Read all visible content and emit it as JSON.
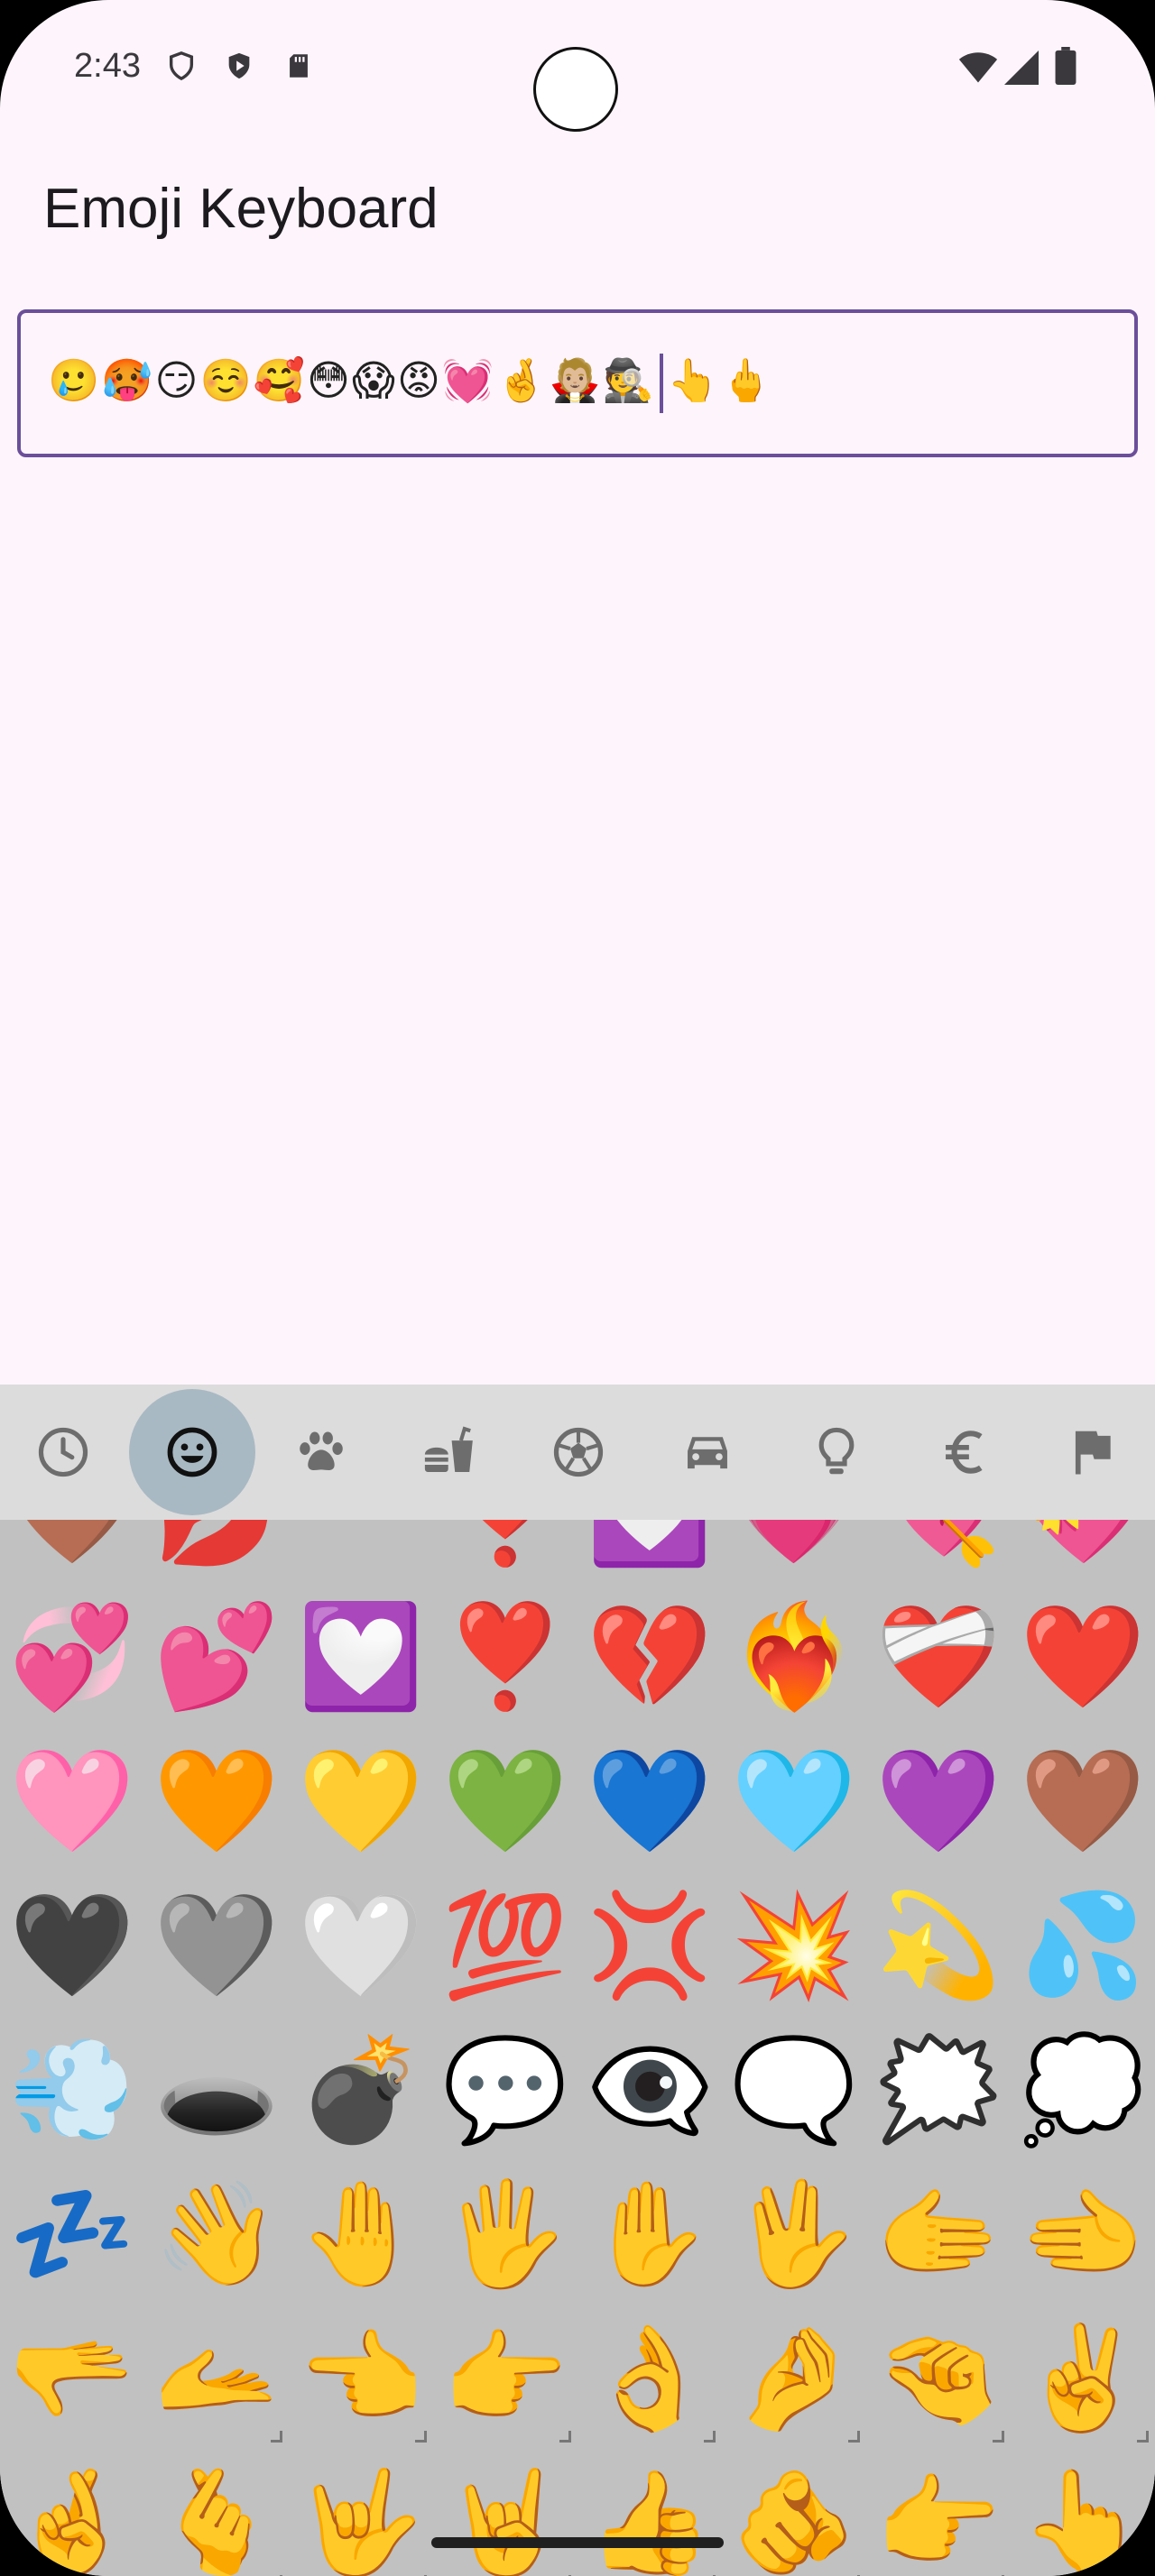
{
  "status_bar": {
    "time": "2:43",
    "left_icons": [
      "shield-outline-icon",
      "shield-play-icon",
      "sd-card-icon"
    ],
    "right_icons": [
      "wifi-icon",
      "signal-icon",
      "battery-icon"
    ]
  },
  "app": {
    "title": "Emoji Keyboard"
  },
  "input": {
    "text_before_caret": "🥲🥵😏☺️🥰😳😱😡💓🤞🧛🏼🕵️",
    "text_after_caret": "👆🖕"
  },
  "categories": [
    {
      "name": "recent",
      "icon": "clock-icon",
      "active": false
    },
    {
      "name": "smileys",
      "icon": "smiley-icon",
      "active": true
    },
    {
      "name": "animals",
      "icon": "paw-icon",
      "active": false
    },
    {
      "name": "food",
      "icon": "burger-drink-icon",
      "active": false
    },
    {
      "name": "activities",
      "icon": "soccer-ball-icon",
      "active": false
    },
    {
      "name": "travel",
      "icon": "car-icon",
      "active": false
    },
    {
      "name": "objects",
      "icon": "lightbulb-icon",
      "active": false
    },
    {
      "name": "symbols",
      "icon": "euro-icon",
      "active": false
    },
    {
      "name": "flags",
      "icon": "flag-icon",
      "active": false
    }
  ],
  "emoji_rows": [
    [
      "🤎",
      "💋",
      "",
      "❣️",
      "💟",
      "💗",
      "💘",
      "💝"
    ],
    [
      "💞",
      "💕",
      "💟",
      "❣️",
      "💔",
      "❤️‍🔥",
      "❤️‍🩹",
      "❤️"
    ],
    [
      "🩷",
      "🧡",
      "💛",
      "💚",
      "💙",
      "🩵",
      "💜",
      "🤎"
    ],
    [
      "🖤",
      "🩶",
      "🤍",
      "💯",
      "💢",
      "💥",
      "💫",
      "💦"
    ],
    [
      "💨",
      "🕳️",
      "💣",
      "💬",
      "👁️‍🗨️",
      "🗨️",
      "🗯️",
      "💭"
    ],
    [
      "💤",
      "👋",
      "🤚",
      "🖐️",
      "✋",
      "🖖",
      "🫱",
      "🫲"
    ],
    [
      "🫳",
      "🫴",
      "👈",
      "👉",
      "👌",
      "🤌",
      "🤏",
      "✌️"
    ],
    [
      "🤞",
      "🫰",
      "🤟",
      "🤘",
      "👍",
      "🫵",
      "👉",
      "👆"
    ]
  ],
  "skin_tone_rows": [
    6,
    7
  ]
}
